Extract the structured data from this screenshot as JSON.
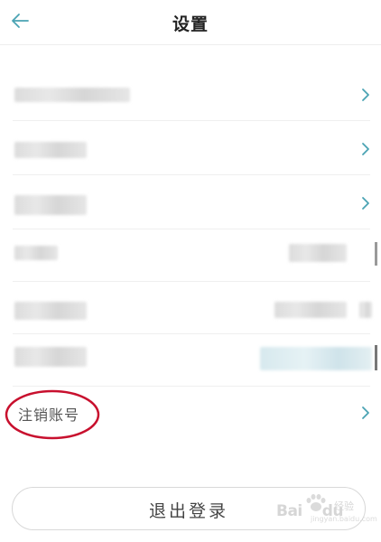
{
  "header": {
    "title": "设置"
  },
  "cancel_account": {
    "label": "注销账号"
  },
  "logout": {
    "label": "退出登录"
  },
  "watermark": {
    "brand": "Bai",
    "brand2": "du",
    "cn": "经验",
    "url": "jingyan.baidu.com"
  },
  "colors": {
    "accent": "#4aa3b3",
    "annotation": "#c8102e"
  },
  "icons": {
    "back": "arrow-left-icon",
    "chevron": "chevron-right-icon"
  }
}
